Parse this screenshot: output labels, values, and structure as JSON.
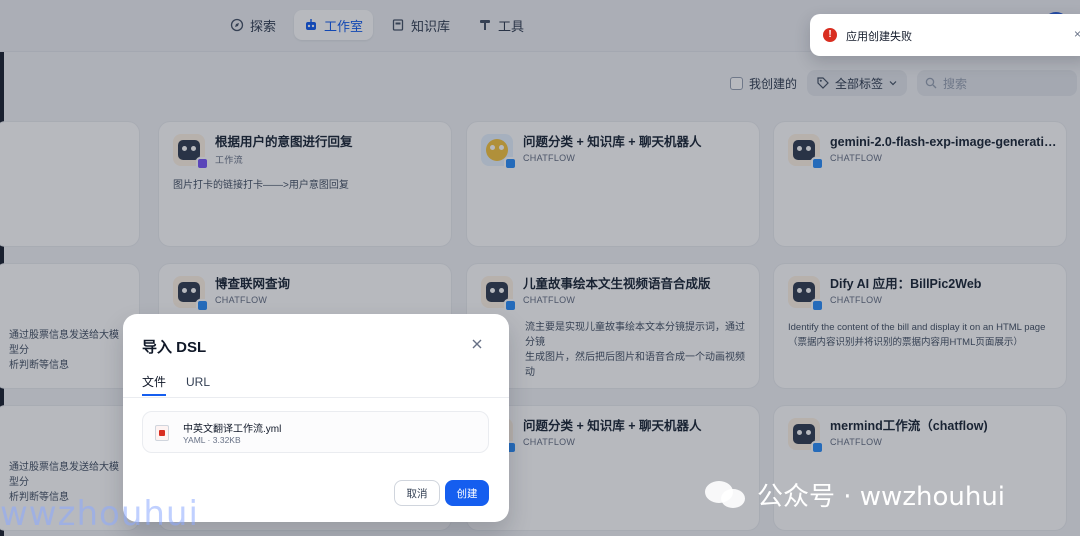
{
  "nav": {
    "items": [
      {
        "label": "探索",
        "icon": "compass-icon",
        "active": false
      },
      {
        "label": "工作室",
        "icon": "robot-icon",
        "active": true
      },
      {
        "label": "知识库",
        "icon": "book-icon",
        "active": false
      },
      {
        "label": "工具",
        "icon": "hammer-icon",
        "active": false
      }
    ]
  },
  "filters": {
    "mine_label": "我创建的",
    "tags_label": "全部标签",
    "search_placeholder": "搜索"
  },
  "cards": [
    {
      "title": "",
      "type": "",
      "desc": ""
    },
    {
      "title": "根据用户的意图进行回复",
      "type": "工作流",
      "desc": "图片打卡的链接打卡——>用户意图回复"
    },
    {
      "title": "问题分类 + 知识库 + 聊天机器人",
      "type": "CHATFLOW",
      "desc": ""
    },
    {
      "title": "gemini-2.0-flash-exp-image-generation-...",
      "type": "CHATFLOW",
      "desc": ""
    },
    {
      "title": "",
      "type": "",
      "desc": "通过股票信息发送给大模型分\n析判断等信息"
    },
    {
      "title": "博查联网查询",
      "type": "CHATFLOW",
      "desc": ""
    },
    {
      "title": "儿童故事绘本文生视频语音合成版",
      "type": "CHATFLOW",
      "desc": "流主要是实现儿童故事绘本文本分镜提示词，通过分镜\n生成图片，然后把后图片和语音合成一个动画视频动"
    },
    {
      "title": "Dify AI 应用：BillPic2Web",
      "type": "CHATFLOW",
      "desc": "Identify the content of the bill and display it on an HTML page\n（票据内容识别并将识别的票据内容用HTML页面展示）"
    },
    {
      "title": "",
      "type": "",
      "desc": "通过股票信息发送给大模型分\n析判断等信息"
    },
    {
      "title": "",
      "type": "",
      "desc": ""
    },
    {
      "title": "问题分类 + 知识库 + 聊天机器人",
      "type": "CHATFLOW",
      "desc": ""
    },
    {
      "title": "mermind工作流（chatflow)",
      "type": "CHATFLOW",
      "desc": ""
    }
  ],
  "modal": {
    "title": "导入 DSL",
    "tabs": [
      "文件",
      "URL"
    ],
    "file_name": "中英文翻译工作流.yml",
    "file_meta": "YAML · 3.32KB",
    "cancel_label": "取消",
    "create_label": "创建"
  },
  "toast": {
    "text": "应用创建失败",
    "close": "×"
  },
  "watermark": {
    "left": "wwzhouhui",
    "right": "公众号 · wwzhouhui"
  },
  "colors": {
    "accent": "#155eef",
    "error": "#d92d20"
  }
}
